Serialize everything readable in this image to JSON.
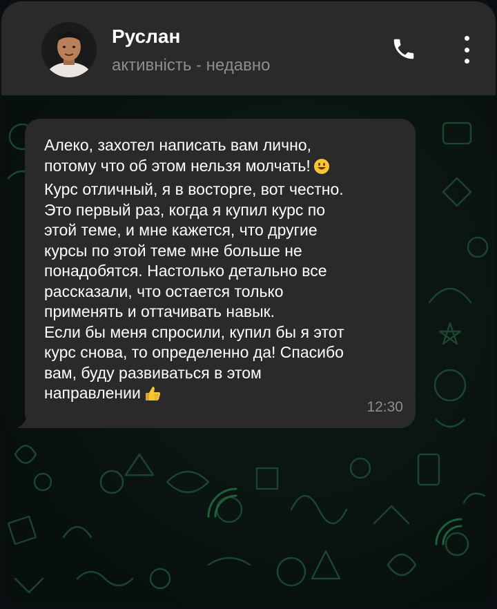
{
  "contact": {
    "name": "Руслан",
    "status": "активність - недавно"
  },
  "header_icons": {
    "call": "phone-icon",
    "menu": "more-vertical-icon"
  },
  "message": {
    "lines": [
      "Алеко, захотел написать вам лично,",
      "потому что об этом нельзя молчать!",
      "Курс отличный, я в восторге, вот честно.",
      "Это первый раз, когда я купил курс по",
      "этой теме, и мне кажется, что другие",
      "курсы по этой теме мне больше не",
      "понадобятся. Настолько детально все",
      "рассказали, что остается только",
      "применять и оттачивать навык.",
      "Если бы меня спросили, купил бы я этот",
      "курс снова, то определенно да! Спасибо",
      "вам, буду развиваться в этом",
      "направлении"
    ],
    "emoji_1": "smiley-face-icon",
    "emoji_2": "thumbs-up-icon",
    "time": "12:30"
  },
  "colors": {
    "header_bg": "#2a2a2b",
    "bubble_bg": "#2a2a2b",
    "wallpaper_doodle": "#1f5c3a",
    "muted_text": "#8e8e8e"
  }
}
